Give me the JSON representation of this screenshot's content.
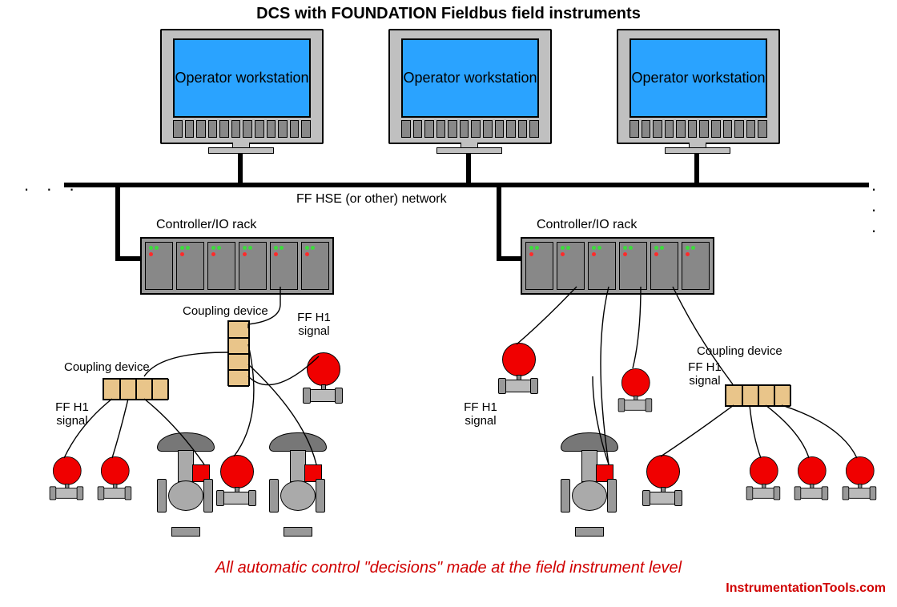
{
  "title": "DCS with FOUNDATION Fieldbus field instruments",
  "workstation_label": "Operator\nworkstation",
  "network_label": "FF HSE (or other) network",
  "rack_label": "Controller/IO rack",
  "coupling_label": "Coupling device",
  "signal_label": "FF H1\nsignal",
  "caption": "All automatic control \"decisions\" made at the field instrument level",
  "watermark": "InstrumentationTools.com",
  "ellipsis": ". . ."
}
